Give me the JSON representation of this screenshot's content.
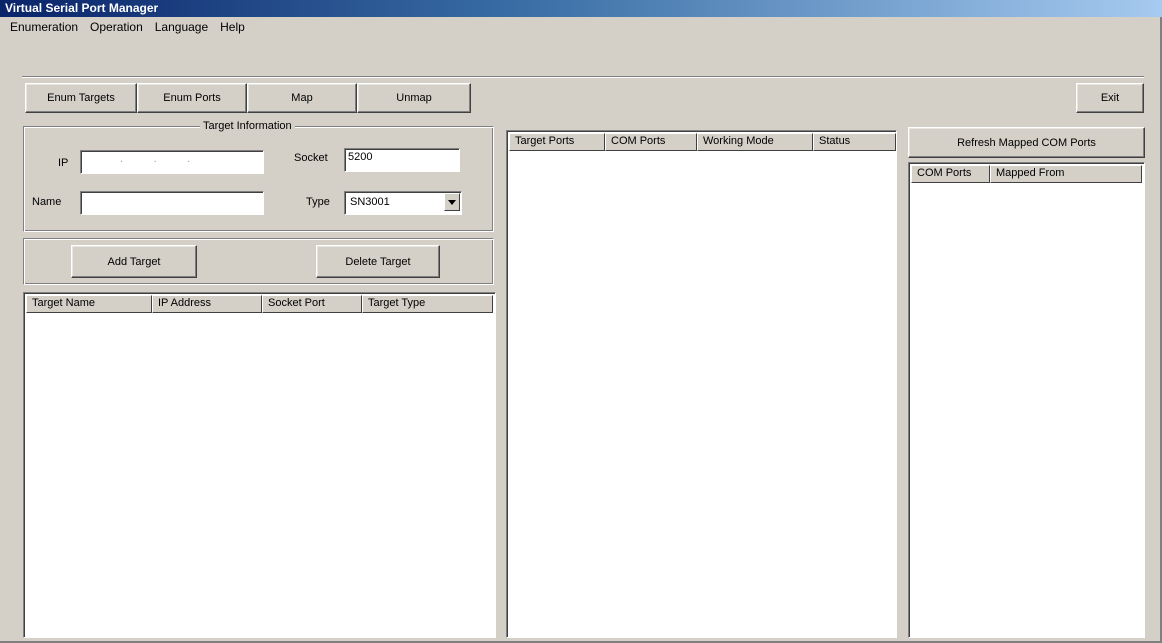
{
  "window": {
    "title": "Virtual Serial Port Manager"
  },
  "menu": [
    "Enumeration",
    "Operation",
    "Language",
    "Help"
  ],
  "toolbar": {
    "enum_targets": "Enum Targets",
    "enum_ports": "Enum Ports",
    "map": "Map",
    "unmap": "Unmap",
    "exit": "Exit"
  },
  "target_info": {
    "title": "Target Information",
    "ip_label": "IP",
    "ip_value": ".          .          .",
    "socket_label": "Socket",
    "socket_value": "5200",
    "name_label": "Name",
    "name_value": "",
    "type_label": "Type",
    "type_value": "SN3001"
  },
  "actions": {
    "add_target": "Add Target",
    "delete_target": "Delete Target"
  },
  "targets_table": {
    "columns": [
      "Target Name",
      "IP Address",
      "Socket Port",
      "Target Type"
    ],
    "rows": []
  },
  "ports_table": {
    "columns": [
      "Target Ports",
      "COM Ports",
      "Working Mode",
      "Status"
    ],
    "rows": []
  },
  "mapped": {
    "refresh_button": "Refresh Mapped COM Ports",
    "columns": [
      "COM Ports",
      "Mapped From"
    ],
    "rows": []
  },
  "colors": {
    "face": "#d4d0c8",
    "title_start": "#0a246a",
    "title_end": "#a6caf0"
  }
}
